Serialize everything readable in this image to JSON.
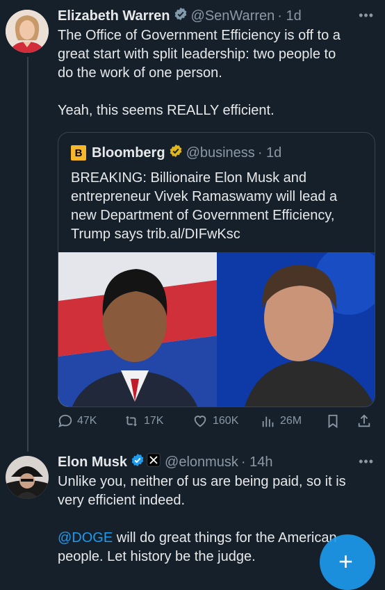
{
  "tweet1": {
    "name": "Elizabeth Warren",
    "handle": "@SenWarren",
    "time": "· 1d",
    "line1": "The Office of Government Efficiency is off to a",
    "line2": "great start with split leadership:  two people to",
    "line3": "do the work of one person.",
    "line4": "Yeah, this seems REALLY efficient."
  },
  "quote": {
    "logo_letter": "B",
    "name": "Bloomberg",
    "handle": "@business",
    "time": "· 1d",
    "line1": "BREAKING: Billionaire Elon Musk and",
    "line2": "entrepreneur Vivek Ramaswamy will lead a",
    "line3": "new Department of Government Efficiency,",
    "line4": "Trump says trib.al/DIFwKsc"
  },
  "actions": {
    "replies": "47K",
    "reposts": "17K",
    "likes": "160K",
    "views": "26M"
  },
  "tweet2": {
    "name": "Elon Musk",
    "handle": "@elonmusk",
    "time": "· 14h",
    "line1": "Unlike you, neither of us are being paid, so it is",
    "line2": "very efficient indeed.",
    "mention": "@DOGE",
    "line3_rest": " will do great things for the American",
    "line4": "people. Let history be the judge."
  },
  "more_label": "•••",
  "fab_label": "+",
  "colors": {
    "accent": "#1d9bf0",
    "gold": "#e2b719",
    "background": "#15202b"
  }
}
